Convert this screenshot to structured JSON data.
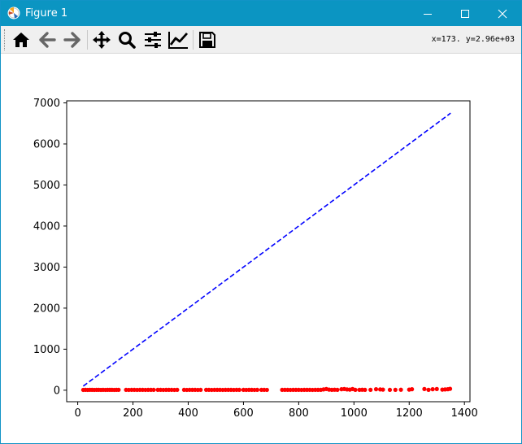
{
  "window": {
    "title": "Figure 1",
    "accent_color": "#0b95c2",
    "title_text_color": "#ffffff"
  },
  "toolbar": {
    "buttons": [
      {
        "name": "home",
        "icon": "home-icon"
      },
      {
        "name": "back",
        "icon": "arrow-left-icon"
      },
      {
        "name": "forward",
        "icon": "arrow-right-icon"
      },
      {
        "name": "pan",
        "icon": "move-arrows-icon"
      },
      {
        "name": "zoom",
        "icon": "magnifier-icon"
      },
      {
        "name": "configure-subplots",
        "icon": "sliders-icon"
      },
      {
        "name": "edit-axis",
        "icon": "line-chart-icon"
      },
      {
        "name": "save",
        "icon": "floppy-disk-icon"
      }
    ],
    "coordinates": "x=173. y=2.96e+03"
  },
  "chart_data": {
    "type": "scatter",
    "title": "",
    "xlabel": "",
    "ylabel": "",
    "xlim": [
      -40,
      1420
    ],
    "ylim": [
      -280,
      7050
    ],
    "x_ticks": [
      0,
      200,
      400,
      600,
      800,
      1000,
      1200,
      1400
    ],
    "y_ticks": [
      0,
      1000,
      2000,
      3000,
      4000,
      5000,
      6000,
      7000
    ],
    "grid": false,
    "series": [
      {
        "style": "red-dots",
        "color": "#ff0000",
        "x": [
          20,
          28,
          36,
          44,
          52,
          60,
          68,
          76,
          84,
          92,
          100,
          108,
          116,
          124,
          132,
          140,
          148,
          175,
          185,
          195,
          205,
          215,
          225,
          235,
          245,
          255,
          265,
          275,
          290,
          300,
          310,
          320,
          330,
          340,
          350,
          360,
          385,
          395,
          405,
          415,
          425,
          435,
          445,
          465,
          475,
          485,
          495,
          505,
          515,
          525,
          535,
          545,
          555,
          565,
          575,
          585,
          600,
          610,
          620,
          630,
          640,
          650,
          665,
          675,
          685,
          740,
          750,
          760,
          770,
          780,
          790,
          800,
          810,
          820,
          830,
          840,
          850,
          860,
          870,
          880,
          890,
          900,
          910,
          920,
          930,
          940,
          955,
          965,
          975,
          985,
          995,
          1005,
          1020,
          1030,
          1040,
          1060,
          1080,
          1095,
          1105,
          1130,
          1150,
          1170,
          1200,
          1210,
          1255,
          1270,
          1285,
          1300,
          1320,
          1330,
          1340,
          1348
        ],
        "y": [
          8,
          9,
          8,
          10,
          9,
          8,
          9,
          10,
          8,
          9,
          8,
          9,
          10,
          9,
          8,
          9,
          10,
          9,
          8,
          10,
          9,
          8,
          9,
          10,
          8,
          9,
          10,
          9,
          10,
          9,
          8,
          9,
          10,
          9,
          8,
          10,
          9,
          8,
          9,
          10,
          9,
          8,
          9,
          10,
          9,
          8,
          9,
          10,
          9,
          8,
          9,
          10,
          9,
          8,
          10,
          9,
          9,
          8,
          10,
          9,
          8,
          9,
          10,
          9,
          8,
          9,
          10,
          9,
          8,
          9,
          10,
          9,
          8,
          9,
          10,
          9,
          8,
          9,
          10,
          9,
          20,
          30,
          15,
          10,
          12,
          9,
          25,
          30,
          20,
          15,
          30,
          9,
          10,
          12,
          9,
          10,
          25,
          20,
          15,
          9,
          10,
          12,
          15,
          25,
          30,
          10,
          25,
          30,
          15,
          20,
          25,
          35
        ]
      },
      {
        "style": "blue-dashed-line",
        "color": "#0000ff",
        "x": [
          20,
          1350
        ],
        "y": [
          100,
          6750
        ]
      }
    ]
  }
}
